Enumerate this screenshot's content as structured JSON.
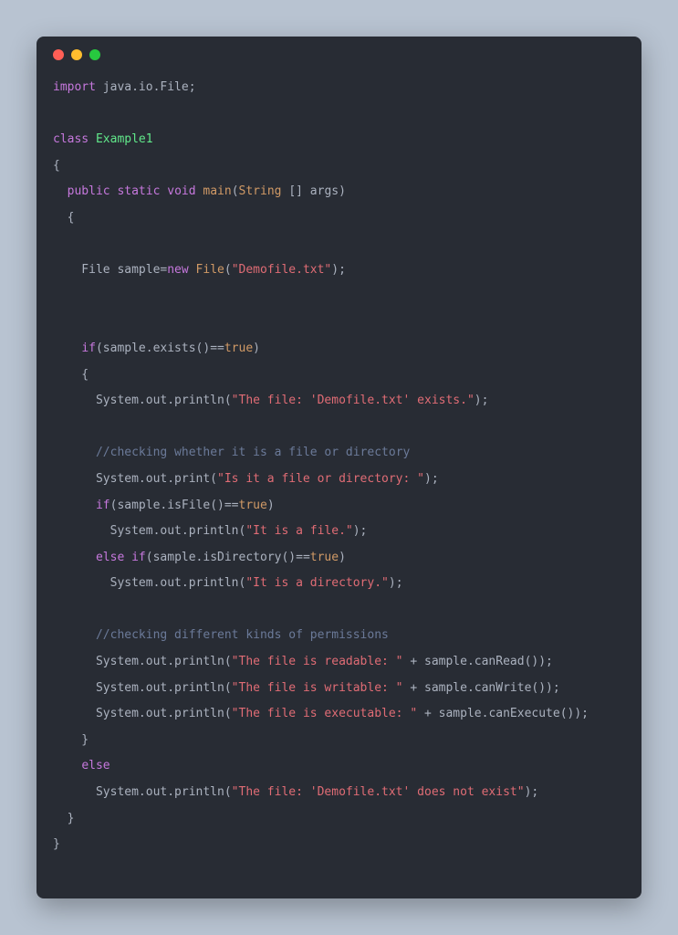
{
  "traffic": {
    "red": "#ff5f56",
    "yellow": "#ffbd2e",
    "green": "#27c93f"
  },
  "code": {
    "l1_import": "import",
    "l1_pkg": " java.io.File;",
    "l3_class": "class",
    "l3_name": " Example1",
    "l4": "{",
    "l5_indent": "  ",
    "l5_public": "public",
    "l5_sp1": " ",
    "l5_static": "static",
    "l5_sp2": " ",
    "l5_void": "void",
    "l5_sp3": " ",
    "l5_main": "main",
    "l5_paren1": "(",
    "l5_string": "String",
    "l5_args": " [] args",
    "l5_paren2": ")",
    "l6": "  {",
    "l8_indent": "    File sample=",
    "l8_new": "new",
    "l8_sp": " ",
    "l8_file": "File",
    "l8_paren1": "(",
    "l8_str": "\"Demofile.txt\"",
    "l8_paren2": ");",
    "l11_indent": "    ",
    "l11_if": "if",
    "l11_expr1": "(sample.exists()==",
    "l11_true": "true",
    "l11_expr2": ")",
    "l12": "    {",
    "l13_indent": "      System.out.println(",
    "l13_str": "\"The file: 'Demofile.txt' exists.\"",
    "l13_end": ");",
    "l15_indent": "      ",
    "l15_cmt": "//checking whether it is a file or directory",
    "l16_indent": "      System.out.print(",
    "l16_str": "\"Is it a file or directory: \"",
    "l16_end": ");",
    "l17_indent": "      ",
    "l17_if": "if",
    "l17_expr1": "(sample.isFile()==",
    "l17_true": "true",
    "l17_expr2": ")",
    "l18_indent": "        System.out.println(",
    "l18_str": "\"It is a file.\"",
    "l18_end": ");",
    "l19_indent": "      ",
    "l19_else": "else",
    "l19_sp": " ",
    "l19_if": "if",
    "l19_expr1": "(sample.isDirectory()==",
    "l19_true": "true",
    "l19_expr2": ")",
    "l20_indent": "        System.out.println(",
    "l20_str": "\"It is a directory.\"",
    "l20_end": ");",
    "l22_indent": "      ",
    "l22_cmt": "//checking different kinds of permissions",
    "l23_indent": "      System.out.println(",
    "l23_str": "\"The file is readable: \"",
    "l23_end": " + sample.canRead());",
    "l24_indent": "      System.out.println(",
    "l24_str": "\"The file is writable: \"",
    "l24_end": " + sample.canWrite());",
    "l25_indent": "      System.out.println(",
    "l25_str": "\"The file is executable: \"",
    "l25_end": " + sample.canExecute());",
    "l26": "    }",
    "l27_indent": "    ",
    "l27_else": "else",
    "l28_indent": "      System.out.println(",
    "l28_str": "\"The file: 'Demofile.txt' does not exist\"",
    "l28_end": ");",
    "l29": "  }",
    "l30": "}"
  }
}
